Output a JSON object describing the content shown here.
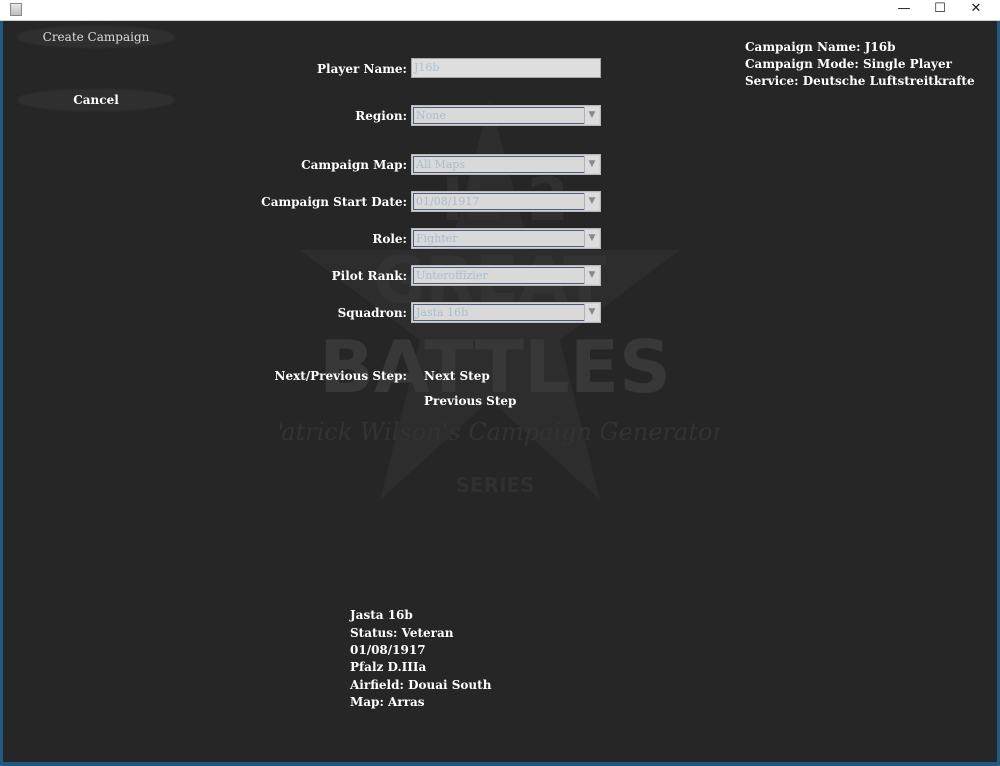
{
  "window": {
    "title_icon": "java-app-icon",
    "minimize_glyph": "—",
    "maximize_glyph": "☐",
    "close_glyph": "✕"
  },
  "left_buttons": {
    "create_campaign": "Create Campaign",
    "cancel": "Cancel"
  },
  "form": {
    "player_name": {
      "label": "Player Name:",
      "value": "J16b"
    },
    "region": {
      "label": "Region:",
      "value": "None"
    },
    "campaign_map": {
      "label": "Campaign Map:",
      "value": "All Maps"
    },
    "start_date": {
      "label": "Campaign Start Date:",
      "value": "01/08/1917"
    },
    "role": {
      "label": "Role:",
      "value": "Fighter"
    },
    "pilot_rank": {
      "label": "Pilot Rank:",
      "value": "Unteroffizier"
    },
    "squadron": {
      "label": "Squadron:",
      "value": "Jasta 16b"
    }
  },
  "steps": {
    "label": "Next/Previous Step:",
    "next": "Next Step",
    "previous": "Previous Step"
  },
  "campaign_summary": {
    "name": "Campaign Name: J16b",
    "mode": "Campaign Mode: Single Player",
    "service": "Service: Deutsche Luftstreitkrafte"
  },
  "squadron_info": {
    "name": "Jasta 16b",
    "status": "Status: Veteran",
    "date": "01/08/1917",
    "aircraft": "Pfalz D.IIIa",
    "airfield": "Airfield: Douai South",
    "map": "Map: Arras"
  },
  "watermark": {
    "line1": "IL-2",
    "line2": "GREAT",
    "line3": "BATTLES",
    "tagline": "Patrick Wilson's Campaign Generator",
    "series": "SERIES"
  },
  "colors": {
    "background": "#252525",
    "frame_border": "#1e5a82",
    "field_text": "#a9bfd3"
  }
}
